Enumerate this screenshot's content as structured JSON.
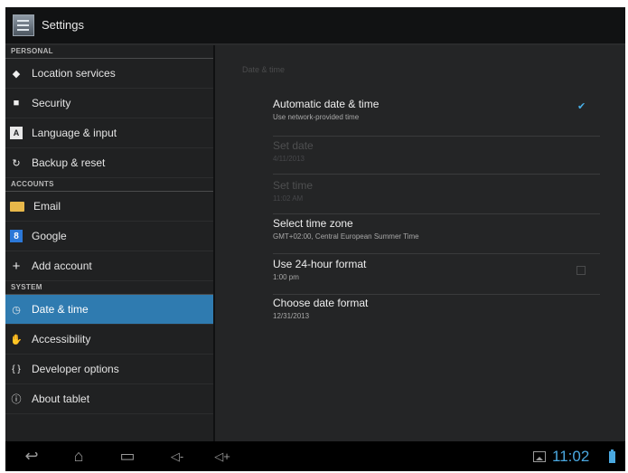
{
  "app": {
    "title": "Settings"
  },
  "sidebar": {
    "sections": [
      {
        "label": "PERSONAL",
        "items": [
          {
            "label": "Location services",
            "icon": "location-icon"
          },
          {
            "label": "Security",
            "icon": "lock-icon"
          },
          {
            "label": "Language & input",
            "icon": "language-icon"
          },
          {
            "label": "Backup & reset",
            "icon": "backup-icon"
          }
        ]
      },
      {
        "label": "ACCOUNTS",
        "items": [
          {
            "label": "Email",
            "icon": "email-icon"
          },
          {
            "label": "Google",
            "icon": "google-icon"
          },
          {
            "label": "Add account",
            "icon": "add-icon"
          }
        ]
      },
      {
        "label": "SYSTEM",
        "items": [
          {
            "label": "Date & time",
            "icon": "clock-icon",
            "selected": true
          },
          {
            "label": "Accessibility",
            "icon": "accessibility-icon"
          },
          {
            "label": "Developer options",
            "icon": "braces-icon"
          },
          {
            "label": "About tablet",
            "icon": "info-icon"
          }
        ]
      }
    ]
  },
  "content": {
    "header": "Date & time",
    "settings": [
      {
        "title": "Automatic date & time",
        "summary": "Use network-provided time",
        "checked": true,
        "enabled": true
      },
      {
        "title": "Set date",
        "summary": "4/11/2013",
        "enabled": false
      },
      {
        "title": "Set time",
        "summary": "11:02 AM",
        "enabled": false
      },
      {
        "title": "Select time zone",
        "summary": "GMT+02:00, Central European Summer Time",
        "enabled": true
      },
      {
        "title": "Use 24-hour format",
        "summary": "1:00 pm",
        "checked": false,
        "enabled": true
      },
      {
        "title": "Choose date format",
        "summary": "12/31/2013",
        "enabled": true
      }
    ]
  },
  "navbar": {
    "back": "↩",
    "home": "⌂",
    "recents": "▭",
    "volume_down": "◁-",
    "volume_up": "◁+",
    "clock": "11:02"
  },
  "colors": {
    "accent": "#2f7bb0",
    "clock": "#4aa8e0",
    "check": "#48b0e8"
  }
}
